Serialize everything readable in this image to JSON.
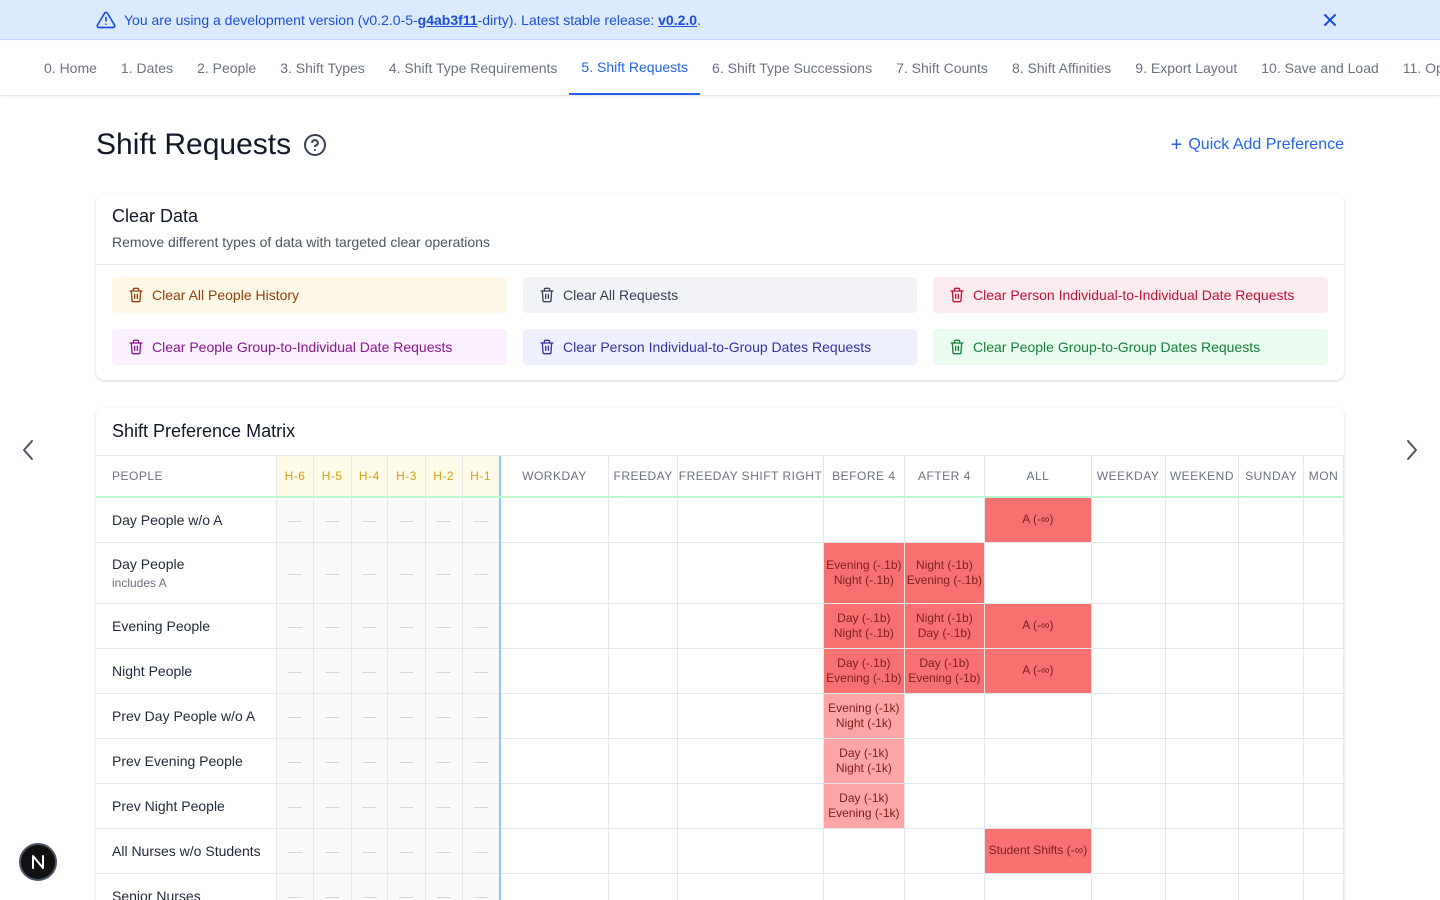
{
  "banner": {
    "prefix": "You are using a development version (v0.2.0-5-",
    "hash": "g4ab3f11",
    "middle": "-dirty). Latest stable release: ",
    "stable": "v0.2.0",
    "suffix": "."
  },
  "tabs": [
    {
      "label": "0. Home"
    },
    {
      "label": "1. Dates"
    },
    {
      "label": "2. People"
    },
    {
      "label": "3. Shift Types"
    },
    {
      "label": "4. Shift Type Requirements"
    },
    {
      "label": "5. Shift Requests",
      "active": true
    },
    {
      "label": "6. Shift Type Successions"
    },
    {
      "label": "7. Shift Counts"
    },
    {
      "label": "8. Shift Affinities"
    },
    {
      "label": "9. Export Layout"
    },
    {
      "label": "10. Save and Load"
    },
    {
      "label": "11. Op"
    }
  ],
  "page": {
    "title": "Shift Requests",
    "quick_add": "Quick Add Preference"
  },
  "clear_data": {
    "title": "Clear Data",
    "subtitle": "Remove different types of data with targeted clear operations",
    "buttons": [
      {
        "label": "Clear All People History",
        "tone": "amber"
      },
      {
        "label": "Clear All Requests",
        "tone": "gray"
      },
      {
        "label": "Clear Person Individual-to-Individual Date Requests",
        "tone": "red"
      },
      {
        "label": "Clear People Group-to-Individual Date Requests",
        "tone": "purple"
      },
      {
        "label": "Clear Person Individual-to-Group Dates Requests",
        "tone": "indigo"
      },
      {
        "label": "Clear People Group-to-Group Dates Requests",
        "tone": "green"
      }
    ]
  },
  "matrix": {
    "title": "Shift Preference Matrix",
    "people_header": "People",
    "history_headers": [
      "H-6",
      "H-5",
      "H-4",
      "H-3",
      "H-2",
      "H-1"
    ],
    "date_headers": [
      "Workday",
      "Freeday",
      "Freeday Shift Right",
      "Before 4",
      "After 4",
      "All",
      "Weekday",
      "Weekend",
      "Sunday",
      "Mon"
    ],
    "empty_mark": "—",
    "rows": [
      {
        "name": "Day People w/o A",
        "sub": "",
        "cells": [
          "",
          "",
          "",
          "",
          "",
          "A (-∞)",
          "",
          "",
          "",
          ""
        ]
      },
      {
        "name": "Day People",
        "sub": "includes A",
        "cells": [
          "",
          "",
          "",
          "Evening (-.1b)\nNight (-.1b)",
          "Night (-1b)\nEvening (-.1b)",
          "",
          "",
          "",
          "",
          ""
        ]
      },
      {
        "name": "Evening People",
        "sub": "",
        "cells": [
          "",
          "",
          "",
          "Day (-.1b)\nNight (-.1b)",
          "Night (-1b)\nDay (-.1b)",
          "A (-∞)",
          "",
          "",
          "",
          ""
        ]
      },
      {
        "name": "Night People",
        "sub": "",
        "cells": [
          "",
          "",
          "",
          "Day (-.1b)\nEvening (-.1b)",
          "Day (-1b)\nEvening (-1b)",
          "A (-∞)",
          "",
          "",
          "",
          ""
        ]
      },
      {
        "name": "Prev Day People w/o A",
        "sub": "",
        "cells": [
          "",
          "",
          "",
          "Evening (-1k)\nNight (-1k)",
          "",
          "",
          "",
          "",
          "",
          ""
        ]
      },
      {
        "name": "Prev Evening People",
        "sub": "",
        "cells": [
          "",
          "",
          "",
          "Day (-1k)\nNight (-1k)",
          "",
          "",
          "",
          "",
          "",
          ""
        ]
      },
      {
        "name": "Prev Night People",
        "sub": "",
        "cells": [
          "",
          "",
          "",
          "Day (-1k)\nEvening (-1k)",
          "",
          "",
          "",
          "",
          "",
          ""
        ]
      },
      {
        "name": "All Nurses w/o Students",
        "sub": "",
        "cells": [
          "",
          "",
          "",
          "",
          "",
          "Student Shifts (-∞)",
          "",
          "",
          "",
          ""
        ]
      },
      {
        "name": "Senior Nurses",
        "sub": "",
        "cells": [
          "",
          "",
          "",
          "",
          "",
          "",
          "",
          "",
          "",
          ""
        ]
      }
    ]
  },
  "fab": {
    "label": "N"
  },
  "colors": {
    "accent": "#2563eb",
    "banner_bg": "#dbeafe",
    "strong_penalty": "#f87171",
    "light_penalty": "#fca5a5"
  },
  "icons": [
    "warning-icon",
    "close-icon",
    "help-circle-icon",
    "plus-icon",
    "trash-icon",
    "chevron-left-icon",
    "chevron-right-icon"
  ]
}
